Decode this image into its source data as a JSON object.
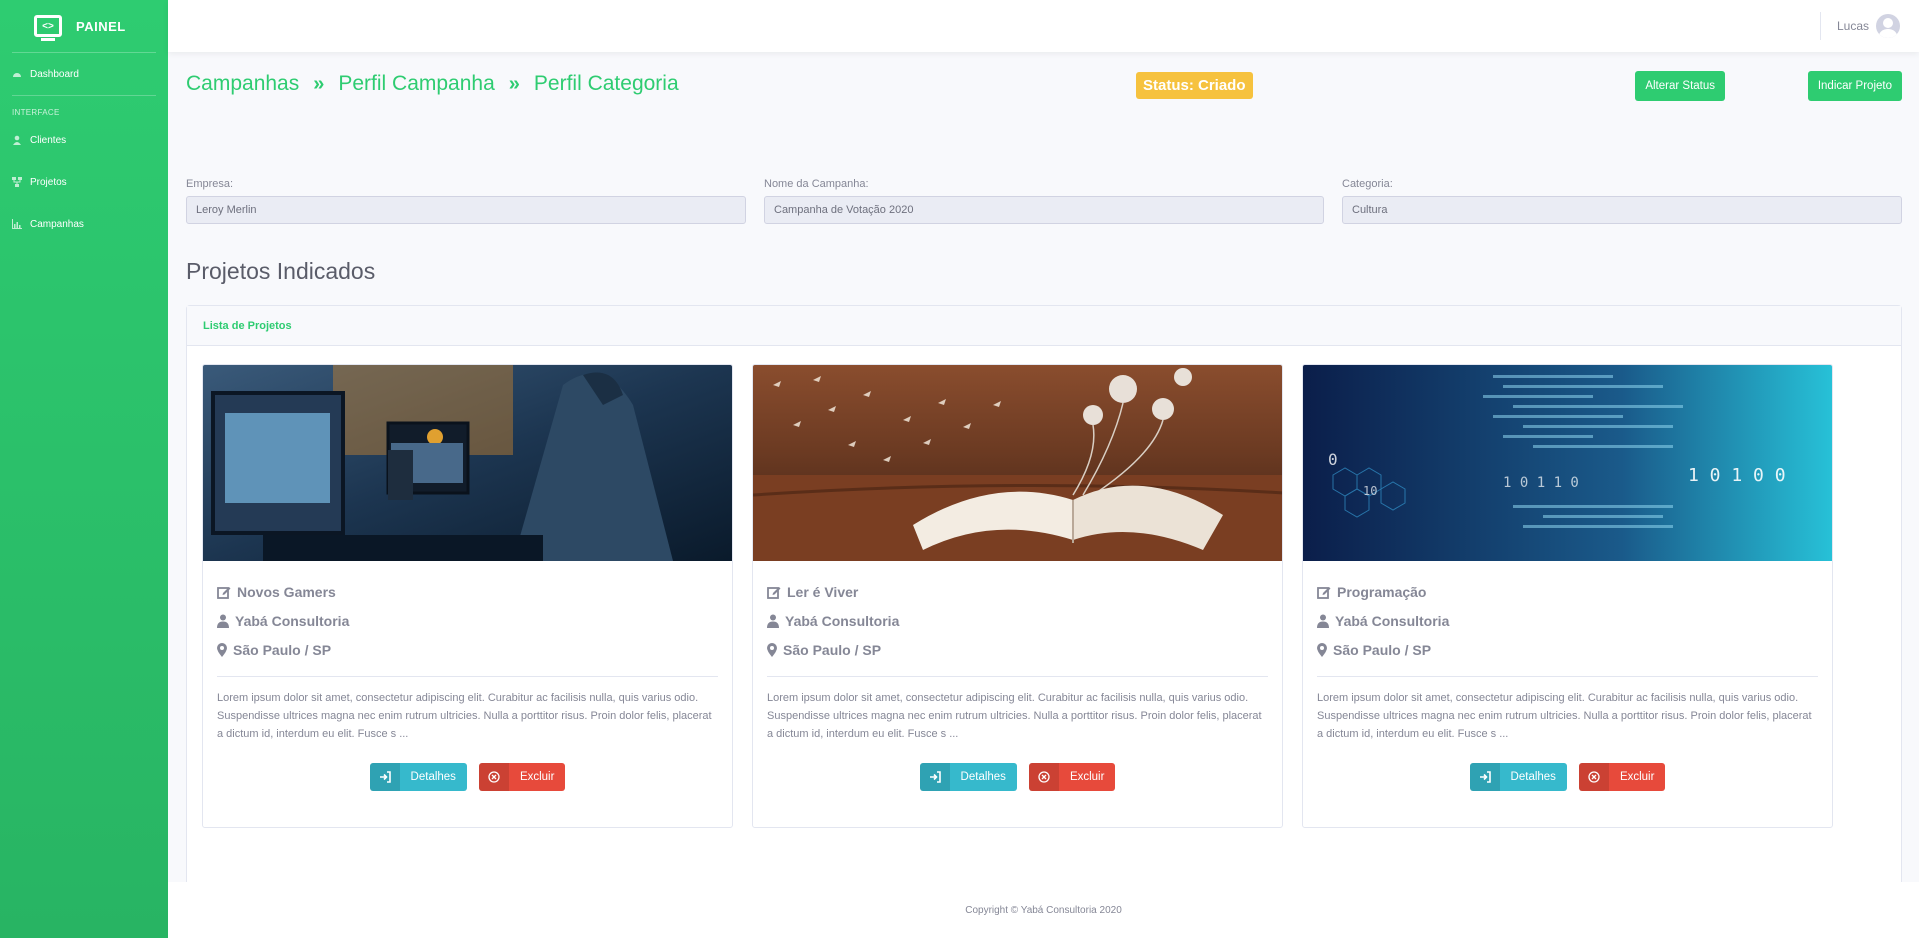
{
  "brand": {
    "name": "PAINEL",
    "icon": "laptop-code-icon"
  },
  "sidebar": {
    "dashboard": "Dashboard",
    "heading": "INTERFACE",
    "items": [
      {
        "label": "Clientes",
        "icon": "user-icon"
      },
      {
        "label": "Projetos",
        "icon": "sitemap-icon"
      },
      {
        "label": "Campanhas",
        "icon": "chart-bar-icon"
      }
    ]
  },
  "topbar": {
    "user_name": "Lucas"
  },
  "breadcrumb": [
    "Campanhas",
    "Perfil Campanha",
    "Perfil Categoria"
  ],
  "status": "Status: Criado",
  "actions": {
    "change_status": "Alterar Status",
    "indicate_project": "Indicar Projeto"
  },
  "form": {
    "empresa": {
      "label": "Empresa:",
      "value": "Leroy Merlin"
    },
    "campanha": {
      "label": "Nome da Campanha:",
      "value": "Campanha de Votação 2020"
    },
    "categoria": {
      "label": "Categoria:",
      "value": "Cultura"
    }
  },
  "section_title": "Projetos Indicados",
  "list_title": "Lista de Projetos",
  "projects": [
    {
      "title": "Novos Gamers",
      "company": "Yabá Consultoria",
      "location": "São Paulo / SP",
      "description": "Lorem ipsum dolor sit amet, consectetur adipiscing elit. Curabitur ac facilisis nulla, quis varius odio. Suspendisse ultrices magna nec enim rutrum ultricies. Nulla a porttitor risus. Proin dolor felis, placerat a dictum id, interdum eu elit. Fusce s ..."
    },
    {
      "title": "Ler é Viver",
      "company": "Yabá Consultoria",
      "location": "São Paulo / SP",
      "description": "Lorem ipsum dolor sit amet, consectetur adipiscing elit. Curabitur ac facilisis nulla, quis varius odio. Suspendisse ultrices magna nec enim rutrum ultricies. Nulla a porttitor risus. Proin dolor felis, placerat a dictum id, interdum eu elit. Fusce s ..."
    },
    {
      "title": "Programação",
      "company": "Yabá Consultoria",
      "location": "São Paulo / SP",
      "description": "Lorem ipsum dolor sit amet, consectetur adipiscing elit. Curabitur ac facilisis nulla, quis varius odio. Suspendisse ultrices magna nec enim rutrum ultricies. Nulla a porttitor risus. Proin dolor felis, placerat a dictum id, interdum eu elit. Fusce s ..."
    }
  ],
  "buttons": {
    "details": "Detalhes",
    "delete": "Excluir"
  },
  "footer": "Copyright © Yabá Consultoria 2020",
  "colors": {
    "primary": "#2ecc71",
    "warning": "#f6c23e",
    "info": "#36b9cc",
    "danger": "#e74a3b"
  }
}
